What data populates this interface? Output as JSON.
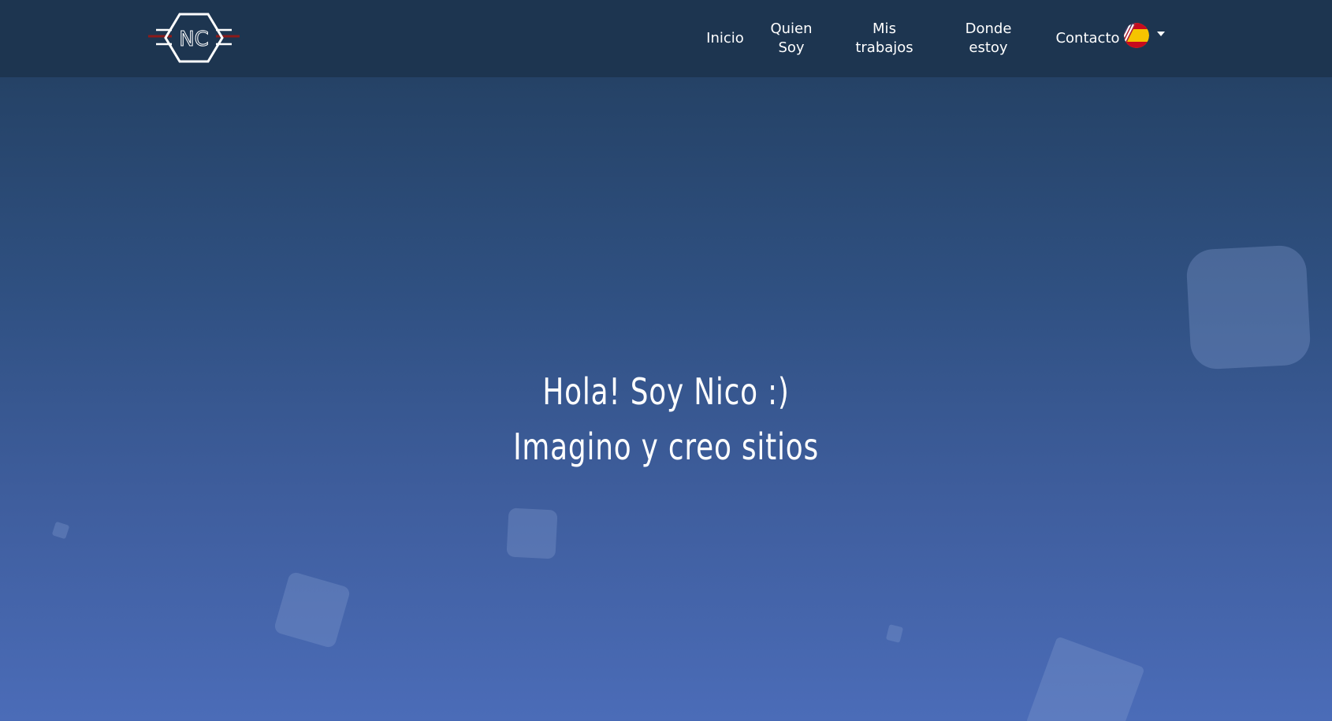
{
  "nav": {
    "logo_text": "NC",
    "links": [
      {
        "line1": "Inicio",
        "line2": ""
      },
      {
        "line1": "Quien",
        "line2": "Soy"
      },
      {
        "line1": "Mis",
        "line2": "trabajos"
      },
      {
        "line1": "Donde",
        "line2": "estoy"
      },
      {
        "line1": "Contacto",
        "line2": ""
      }
    ],
    "language_icon": "us-es-flag-icon"
  },
  "hero": {
    "line1": "Hola! Soy Nico :)",
    "line2": "Imagino y creo sitios"
  },
  "colors": {
    "navbar": "#1d3550",
    "gradient_top": "#213d5c",
    "gradient_bottom": "#4b6cb8",
    "logo_accent": "#8b1a1a",
    "text": "#ffffff"
  }
}
